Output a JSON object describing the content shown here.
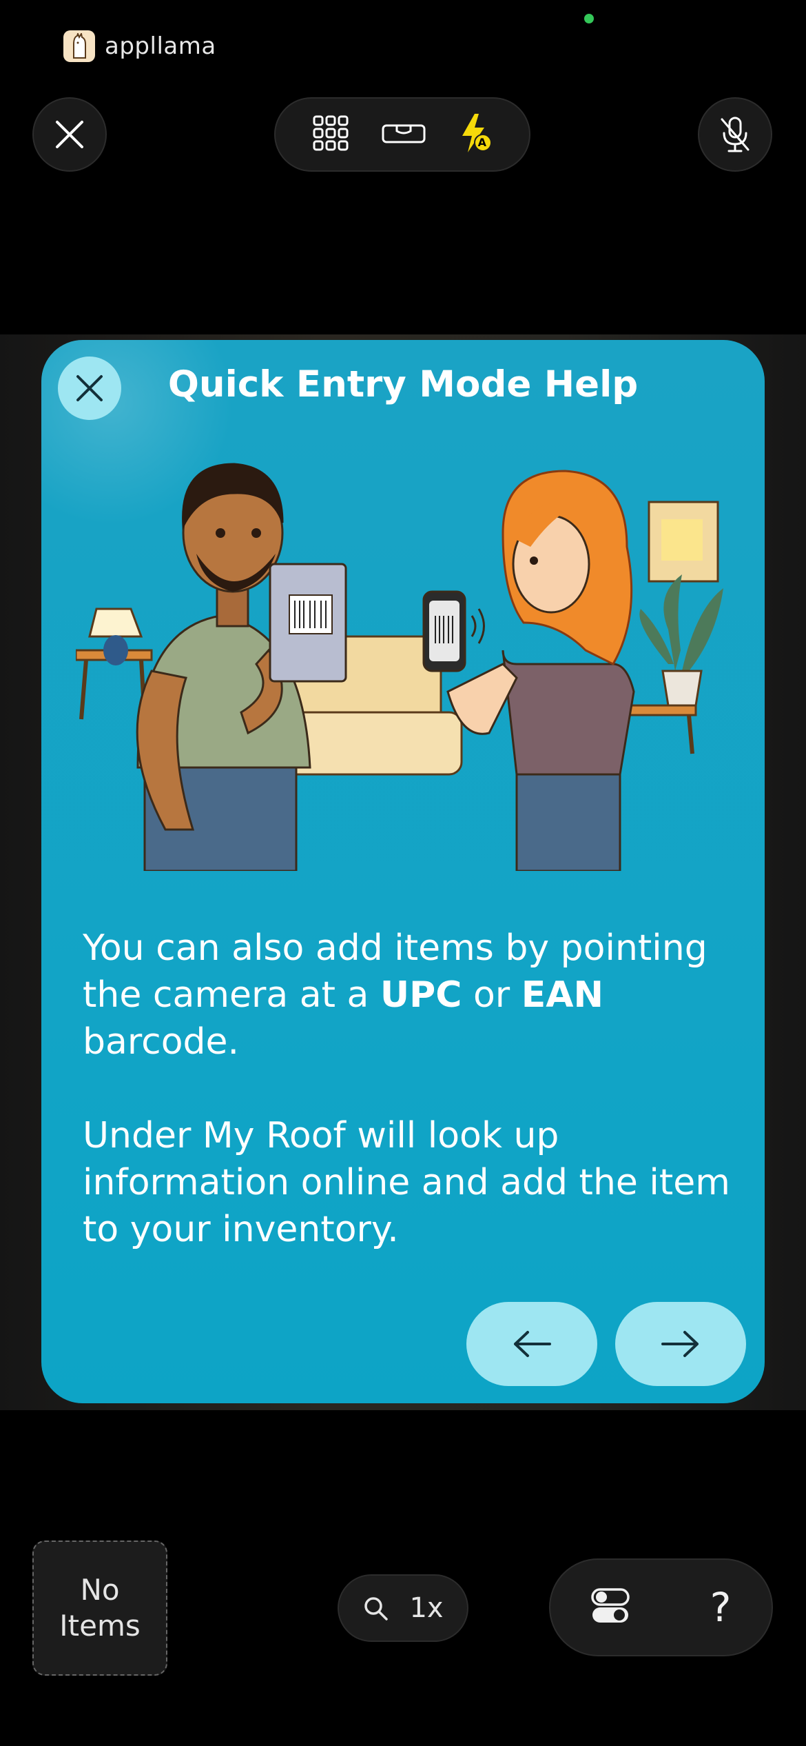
{
  "brand": {
    "name": "appllama"
  },
  "top_bar": {
    "close_icon": "close-icon",
    "grid_icon": "grid-icon",
    "level_icon": "level-icon",
    "flash_icon": "flash-auto-icon",
    "flash_badge": "A",
    "mic_icon": "mic-off-icon"
  },
  "help_card": {
    "title": "Quick Entry Mode Help",
    "para1_pre": "You can also add items by pointing the camera at a ",
    "para1_upc": "UPC",
    "para1_mid": " or ",
    "para1_ean": "EAN",
    "para1_post": " barcode.",
    "para2": "Under My Roof will look up information online and add the item to your inventory.",
    "prev_icon": "arrow-left-icon",
    "next_icon": "arrow-right-icon"
  },
  "bottom_bar": {
    "items_line1": "No",
    "items_line2": "Items",
    "zoom_label": "1x",
    "help_label": "?"
  },
  "colors": {
    "card": "#0da4c6",
    "button": "#9ee6f2",
    "status_dot": "#34c759"
  }
}
